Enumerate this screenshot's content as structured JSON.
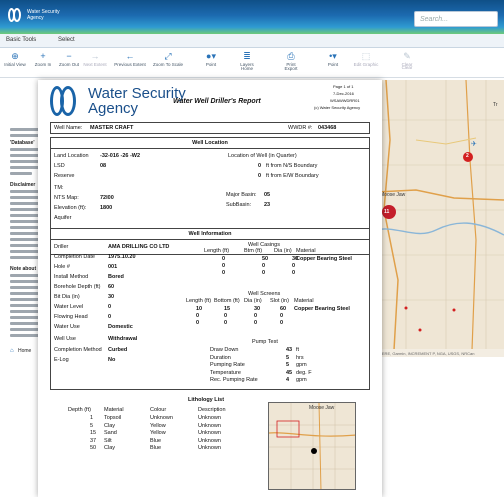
{
  "brand": {
    "line1": "Water Security",
    "line2": "Agency"
  },
  "search": {
    "placeholder": "Search..."
  },
  "tabs": [
    "Basic Tools",
    "Select"
  ],
  "toolbar": [
    {
      "label": "Initial View",
      "icon": "globe-icon",
      "enabled": true
    },
    {
      "label": "Zoom In",
      "icon": "zoom-in-icon",
      "enabled": true
    },
    {
      "label": "Zoom Out",
      "icon": "zoom-out-icon",
      "enabled": true
    },
    {
      "label": "Next Extent",
      "icon": "next-extent-icon",
      "enabled": false
    },
    {
      "label": "Previous Extent",
      "icon": "previous-extent-icon",
      "enabled": true
    },
    {
      "label": "Zoom To Scale",
      "icon": "zoom-to-scale-icon",
      "enabled": true
    },
    {
      "label": "Point",
      "icon": "point-icon",
      "enabled": true
    },
    {
      "label": "Layers",
      "icon": "layers-icon",
      "enabled": true
    },
    {
      "label": "Home",
      "icon": "home-icon",
      "enabled": true
    },
    {
      "label": "Print",
      "icon": "print-icon",
      "enabled": true
    },
    {
      "label": "Export",
      "icon": "export-icon",
      "enabled": true
    },
    {
      "label": "Point",
      "icon": "point-icon",
      "enabled": true
    },
    {
      "label": "Edit Graphic",
      "icon": "edit-graphic-icon",
      "enabled": false
    },
    {
      "label": "Clear",
      "icon": "clear-icon",
      "enabled": false
    },
    {
      "label": "Clear",
      "icon": "clear-icon",
      "enabled": false
    }
  ],
  "left_panel": {
    "title": "W",
    "snippets": [
      "'Database'",
      "Disclaimer",
      "Note about",
      "Home"
    ]
  },
  "map": {
    "labels": [
      "Moose Jaw",
      "Tr"
    ],
    "markers": [
      {
        "label": "2"
      },
      {
        "label": "11"
      }
    ],
    "attribution": "HERE, Garmin, INCREMENT P, NGA, USGS, NRCan"
  },
  "report": {
    "agency_line1": "Water Security",
    "agency_line2": "Agency",
    "title": "Water Well Driller's Report",
    "page": "Page 1 of 1",
    "date": "7-Dec-2016",
    "code": "WSAWWDRR01",
    "copyright": "(c) Water Security Agency",
    "well_name_label": "Well Name:",
    "well_name": "MASTER CRAFT",
    "wwdr_label": "WWDR #:",
    "wwdr": "043468",
    "location": {
      "header": "Well Location",
      "legal_label": "Land Location",
      "legal": "-32-016 -26 -W2",
      "lsd_label": "LSD",
      "lsd": "08",
      "reserve_label": "Reserve",
      "quarter_label": "Location of Well (in Quarter)",
      "ns": "0",
      "ns_label": "ft from N/S Boundary",
      "ew": "0",
      "ew_label": "ft from E/W Boundary",
      "tm_label": "TM:",
      "nts_label": "NTS Map:",
      "nts": "72I00",
      "elev_label": "Elevation (ft):",
      "elev": "1800",
      "aquifer_label": "Aquifer",
      "major_label": "Major Basin:",
      "major": "05",
      "sub_label": "SubBasin:",
      "sub": "23"
    },
    "info": {
      "header": "Well Information",
      "fields": [
        {
          "label": "Driller",
          "value": "AMA DRILLING CO LTD"
        },
        {
          "label": "Completion Date",
          "value": "1975.10.20"
        },
        {
          "label": "Hole #",
          "value": "001"
        },
        {
          "label": "Install Method",
          "value": "Bored"
        },
        {
          "label": "Borehole Depth (ft)",
          "value": "60"
        },
        {
          "label": "Bit Dia (in)",
          "value": "30"
        },
        {
          "label": "Water Level",
          "value": "0"
        },
        {
          "label": "Flowing Head",
          "value": "0"
        },
        {
          "label": "Water Use",
          "value": "Domestic"
        },
        {
          "label": "Well Use",
          "value": "Withdrawal"
        },
        {
          "label": "Completion Method",
          "value": "Curbed"
        },
        {
          "label": "E-Log",
          "value": "No"
        }
      ],
      "casings": {
        "title": "Well Casings",
        "headers": [
          "Length (ft)",
          "Btm (ft)",
          "Dia (in)",
          "Material"
        ],
        "rows": [
          [
            "0",
            "50",
            "30",
            "Copper Bearing Steel"
          ],
          [
            "0",
            "0",
            "0",
            ""
          ],
          [
            "0",
            "0",
            "0",
            ""
          ]
        ]
      },
      "screens": {
        "title": "Well Screens",
        "headers": [
          "Length (ft)",
          "Bottom (ft)",
          "Dia (in)",
          "Slot (in)",
          "Material"
        ],
        "rows": [
          [
            "10",
            "15",
            "30",
            "60",
            "Copper Bearing Steel"
          ],
          [
            "0",
            "0",
            "0",
            "0",
            ""
          ],
          [
            "0",
            "0",
            "0",
            "0",
            ""
          ]
        ]
      },
      "pump": {
        "title": "Pump Test",
        "rows": [
          {
            "label": "Draw Down",
            "value": "43",
            "unit": "ft"
          },
          {
            "label": "Duration",
            "value": "5",
            "unit": "hrs"
          },
          {
            "label": "Pumping Rate",
            "value": "5",
            "unit": "gpm"
          },
          {
            "label": "Temperature",
            "value": "45",
            "unit": "deg. F"
          },
          {
            "label": "Rec. Pumping Rate",
            "value": "4",
            "unit": "gpm"
          }
        ]
      }
    },
    "lithology": {
      "title": "Lithology List",
      "headers": [
        "Depth (ft)",
        "Material",
        "Colour",
        "Description"
      ],
      "rows": [
        [
          "1",
          "Topsoil",
          "Unknown",
          "Unknown"
        ],
        [
          "5",
          "Clay",
          "Yellow",
          "Unknown"
        ],
        [
          "15",
          "Sand",
          "Yellow",
          "Unknown"
        ],
        [
          "37",
          "Silt",
          "Blue",
          "Unknown"
        ],
        [
          "50",
          "Clay",
          "Blue",
          "Unknown"
        ]
      ],
      "map_label": "Moose Jaw"
    }
  }
}
